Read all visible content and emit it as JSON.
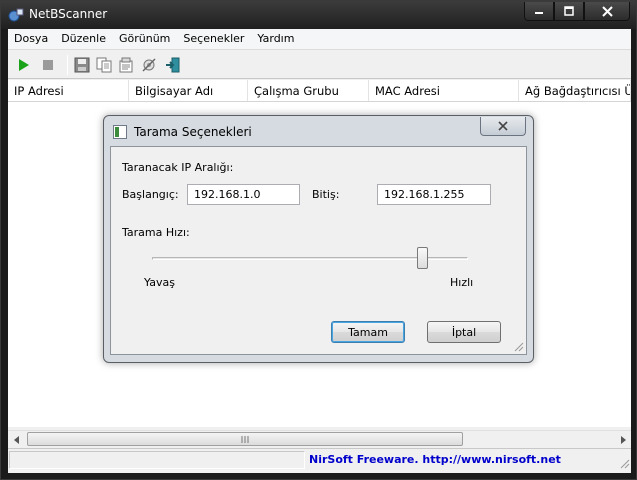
{
  "window": {
    "title": "NetBScanner"
  },
  "menu": {
    "items": [
      "Dosya",
      "Düzenle",
      "Görünüm",
      "Seçenekler",
      "Yardım"
    ]
  },
  "toolbar": {
    "icons": [
      "start-icon",
      "stop-icon",
      "save-icon",
      "copy-icon",
      "properties-icon",
      "options-icon",
      "exit-icon"
    ]
  },
  "columns": [
    "IP Adresi",
    "Bilgisayar Adı",
    "Çalışma Grubu",
    "MAC Adresi",
    "Ağ Bağdaştırıcısı Üre"
  ],
  "status": {
    "link": "NirSoft Freeware.  http://www.nirsoft.net"
  },
  "dialog": {
    "title": "Tarama Seçenekleri",
    "range_label": "Taranacak IP Aralığı:",
    "start_label": "Başlangıç:",
    "start_value": "192.168.1.0",
    "end_label": "Bitiş:",
    "end_value": "192.168.1.255",
    "speed_label": "Tarama Hızı:",
    "slow_label": "Yavaş",
    "fast_label": "Hızlı",
    "speed_level": 0.87,
    "ok_label": "Tamam",
    "cancel_label": "İptal"
  },
  "colors": {
    "status_link": "#0000cc",
    "play_green": "#1aa31a"
  }
}
